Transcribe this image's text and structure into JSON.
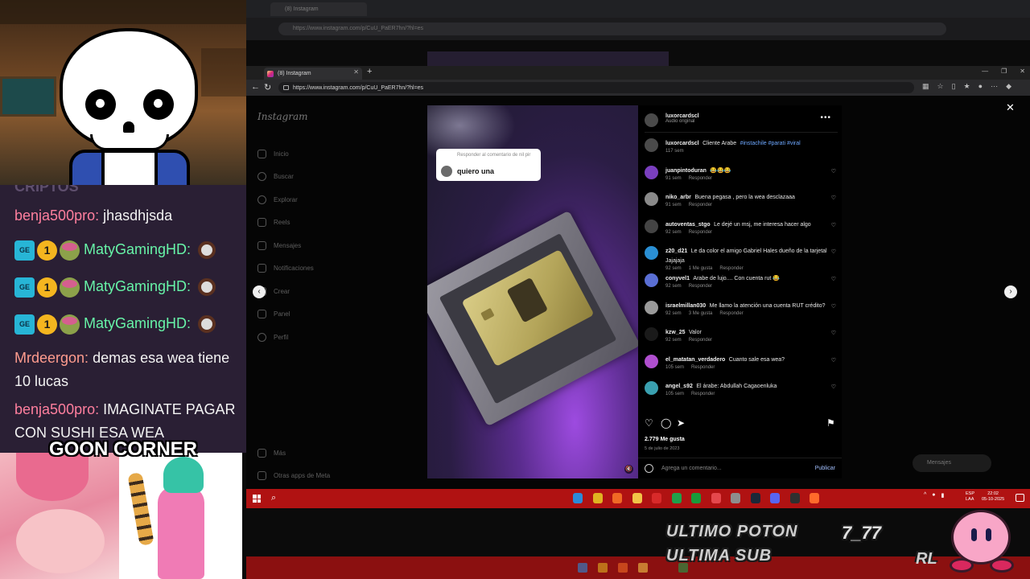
{
  "background": {
    "tab_title": "(8) Instagram",
    "url": "https://www.instagram.com/p/CuU_PaER7hn/?hl=es"
  },
  "browser": {
    "tab_title": "(8) Instagram",
    "url": "https://www.instagram.com/p/CuU_PaER7hn/?hl=es"
  },
  "instagram": {
    "logo": "Instagram",
    "nav": [
      {
        "label": "Inicio",
        "icon": "home-icon"
      },
      {
        "label": "Buscar",
        "icon": "search-icon"
      },
      {
        "label": "Explorar",
        "icon": "compass-icon"
      },
      {
        "label": "Reels",
        "icon": "reels-icon"
      },
      {
        "label": "Mensajes",
        "icon": "messenger-icon"
      },
      {
        "label": "Notificaciones",
        "icon": "heart-icon"
      },
      {
        "label": "Crear",
        "icon": "plus-icon"
      },
      {
        "label": "Panel",
        "icon": "chart-icon"
      },
      {
        "label": "Perfil",
        "icon": "avatar-icon"
      }
    ],
    "nav_bottom": [
      {
        "label": "Más",
        "icon": "menu-icon"
      },
      {
        "label": "Otras apps de Meta",
        "icon": "meta-icon"
      }
    ],
    "post": {
      "reply_header": "Responder al comentario de nil pir",
      "reply_text": "quiero una",
      "author": "luxorcardscl",
      "audio": "Audio original",
      "caption_user": "luxorcardscl",
      "caption_text": "Cliente Arabe",
      "caption_tags": "#instachile #parati #viral",
      "caption_time": "117 sem",
      "comments": [
        {
          "user": "juanpintoduran",
          "text": "😂😂😂",
          "time": "91 sem",
          "likes": "",
          "reply": "Responder",
          "avatar_color": "#7a3fbf"
        },
        {
          "user": "niko_arbr",
          "text": "Buena pegasa , pero la wea desclazaaa",
          "time": "91 sem",
          "likes": "",
          "reply": "Responder",
          "avatar_color": "#8a8a8a"
        },
        {
          "user": "autoventas_stgo",
          "text": "Le dejé un msj, me interesa hacer algo",
          "time": "92 sem",
          "likes": "",
          "reply": "Responder",
          "avatar_color": "#444444"
        },
        {
          "user": "z20_d21",
          "text": "Le da color el amigo Gabriel Hales dueño de la tarjetal Jajajaja",
          "time": "92 sem",
          "likes": "1 Me gusta",
          "reply": "Responder",
          "avatar_color": "#2a8fd4"
        },
        {
          "user": "conyvel1",
          "text": "Arabe de lujo.... Con cuenta rut 😂",
          "time": "92 sem",
          "likes": "",
          "reply": "Responder",
          "avatar_color": "#5a6fd4"
        },
        {
          "user": "israelmillan030",
          "text": "Me llamo la atención una cuenta RUT crédito?",
          "time": "92 sem",
          "likes": "3 Me gusta",
          "reply": "Responder",
          "avatar_color": "#9a9a9a"
        },
        {
          "user": "kzw_25",
          "text": "Valor",
          "time": "92 sem",
          "likes": "",
          "reply": "Responder",
          "avatar_color": "#1a1a1a"
        },
        {
          "user": "el_matatan_verdadero",
          "text": "Cuanto sale esa wea?",
          "time": "105 sem",
          "likes": "",
          "reply": "Responder",
          "avatar_color": "#b04fcf"
        },
        {
          "user": "angel_s92",
          "text": "El árabe: Abdullah Cagaoenluka",
          "time": "105 sem",
          "likes": "",
          "reply": "Responder",
          "avatar_color": "#3aa0b0"
        }
      ],
      "likes": "2.779 Me gusta",
      "date": "5 de julio de 2023",
      "comment_placeholder": "Agrega un comentario...",
      "publish": "Publicar"
    },
    "messages": "Mensajes"
  },
  "taskbar": {
    "lang": "ESP\nLAA",
    "time": "22:02",
    "date": "05-10-2025",
    "apps": [
      {
        "icon": "edge-icon",
        "color": "#2b8bd8"
      },
      {
        "icon": "chrome-icon",
        "color": "#e0b321"
      },
      {
        "icon": "brave-icon",
        "color": "#f06a25"
      },
      {
        "icon": "folder-icon",
        "color": "#f2c447"
      },
      {
        "icon": "pdf-icon",
        "color": "#d82a2a"
      },
      {
        "icon": "spreadsheet-icon",
        "color": "#1fa04a"
      },
      {
        "icon": "media-icon",
        "color": "#1a9a3a"
      },
      {
        "icon": "valorant-icon",
        "color": "#e5484d"
      },
      {
        "icon": "settings-icon",
        "color": "#8e8e8e"
      },
      {
        "icon": "steam-icon",
        "color": "#1b2838"
      },
      {
        "icon": "discord-icon",
        "color": "#5865f2"
      },
      {
        "icon": "obs-icon",
        "color": "#303030"
      },
      {
        "icon": "browser-active-icon",
        "color": "#ff6a2b"
      }
    ]
  },
  "stream": {
    "chat_title": "CRIPTOS",
    "messages": [
      {
        "user": "benja500pro:",
        "text": "jhasdhjsda",
        "style": "pink",
        "badges": false,
        "emote": false
      },
      {
        "user": "MatyGamingHD:",
        "text": "",
        "style": "green",
        "badges": true,
        "emote": true
      },
      {
        "user": "MatyGamingHD:",
        "text": "",
        "style": "green",
        "badges": true,
        "emote": true
      },
      {
        "user": "MatyGamingHD:",
        "text": "",
        "style": "green",
        "badges": true,
        "emote": true
      },
      {
        "user": "Mrdeergon:",
        "text": "demas esa wea tiene 10 lucas",
        "style": "peach",
        "badges": false,
        "emote": false
      },
      {
        "user": "benja500pro:",
        "text": "IMAGINATE PAGAR CON SUSHI ESA WEA",
        "style": "pink",
        "badges": false,
        "emote": false
      }
    ],
    "goon_title": "GOON CORNER",
    "overlay_line1": "ULTIMO POTON",
    "overlay_line2": "ULTIMA SUB",
    "overlay_sevens": "7_77",
    "overlay_rl": "RL"
  }
}
